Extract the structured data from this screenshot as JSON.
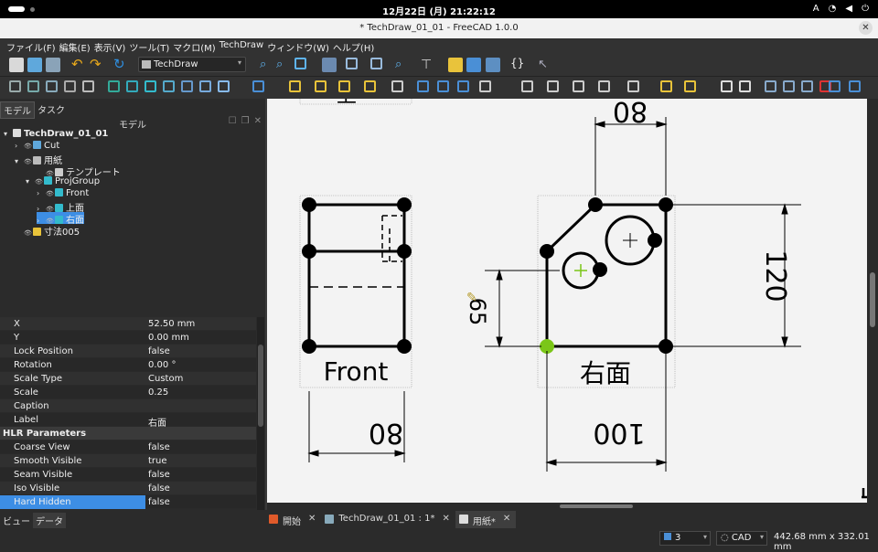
{
  "system_bar": {
    "clock": "12月22日 (月)  21:22:12",
    "input_method": "A"
  },
  "window": {
    "title": "* TechDraw_01_01 - FreeCAD 1.0.0"
  },
  "menu": [
    "ファイル(F)",
    "編集(E)",
    "表示(V)",
    "ツール(T)",
    "マクロ(M)",
    "TechDraw",
    "ウィンドウ(W)",
    "ヘルプ(H)"
  ],
  "toolbar": {
    "workbench": "TechDraw",
    "braces_label": "{}"
  },
  "left_panel": {
    "tabs": [
      "モデル",
      "タスク"
    ],
    "title": "モデル",
    "tree": [
      {
        "label": "TechDraw_01_01",
        "bold": true
      },
      {
        "label": "Cut"
      },
      {
        "label": "用紙"
      },
      {
        "label": "テンプレート"
      },
      {
        "label": "ProjGroup"
      },
      {
        "label": "Front"
      },
      {
        "label": "上面"
      },
      {
        "label": "右面",
        "selected": true
      },
      {
        "label": "寸法005"
      }
    ],
    "properties": [
      {
        "key": "X",
        "value": "52.50 mm"
      },
      {
        "key": "Y",
        "value": "0.00 mm"
      },
      {
        "key": "Lock Position",
        "value": "false"
      },
      {
        "key": "Rotation",
        "value": "0.00 °"
      },
      {
        "key": "Scale Type",
        "value": "Custom"
      },
      {
        "key": "Scale",
        "value": "0.25"
      },
      {
        "key": "Caption",
        "value": ""
      },
      {
        "key": "Label",
        "value": "右面"
      },
      {
        "key": "HLR Parameters",
        "value": "",
        "group": true
      },
      {
        "key": "Coarse View",
        "value": "false"
      },
      {
        "key": "Smooth Visible",
        "value": "true"
      },
      {
        "key": "Seam Visible",
        "value": "false"
      },
      {
        "key": "Iso Visible",
        "value": "false"
      },
      {
        "key": "Hard Hidden",
        "value": "false",
        "highlight": true
      }
    ],
    "bottom_tabs": [
      "ビュー",
      "データ"
    ]
  },
  "drawing": {
    "front_label": "Front",
    "right_label": "右面",
    "dim_top": "80",
    "dim_front_width": "80",
    "dim_right_width": "100",
    "dim_right_height": "120",
    "dim_hole": "65"
  },
  "doc_tabs": [
    {
      "label": "開始"
    },
    {
      "label": "TechDraw_01_01 : 1*"
    },
    {
      "label": "用紙*",
      "active": true
    }
  ],
  "status": {
    "page": "3",
    "nav": "CAD",
    "dimensions": "442.68 mm x 332.01 mm"
  },
  "colors": {
    "accent": "#3d8ee5",
    "canvas": "#f3f3f3",
    "green_point": "#7bc618"
  }
}
